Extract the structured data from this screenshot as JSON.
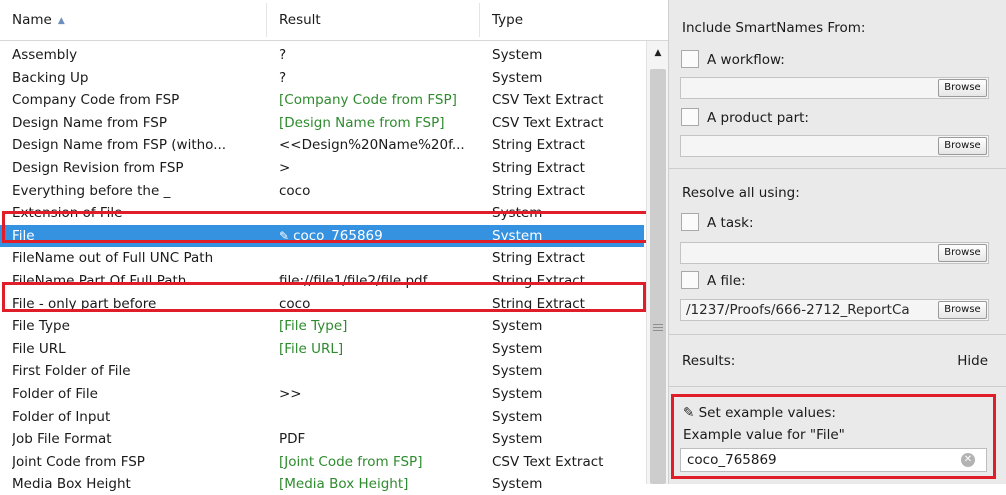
{
  "table": {
    "columns": [
      "Name",
      "Result",
      "Type"
    ],
    "sort_indicator": "▲",
    "rows": [
      {
        "name": "Assembly",
        "result": "?",
        "type": "System",
        "green": false
      },
      {
        "name": "Backing Up",
        "result": "?",
        "type": "System",
        "green": false
      },
      {
        "name": "Company Code from FSP",
        "result": "[Company Code from FSP]",
        "type": "CSV Text Extract",
        "green": true
      },
      {
        "name": "Design Name from FSP",
        "result": "[Design Name from FSP]",
        "type": "CSV Text Extract",
        "green": true
      },
      {
        "name": "Design Name from FSP (witho...",
        "result": "<<Design%20Name%20f...",
        "type": "String Extract",
        "green": false
      },
      {
        "name": "Design Revision from FSP",
        "result": ">",
        "type": "String Extract",
        "green": false
      },
      {
        "name": "Everything before the _",
        "result": "coco",
        "type": "String Extract",
        "green": false
      },
      {
        "name": "Extension of File",
        "result": "",
        "type": "System",
        "green": false
      },
      {
        "name": "File",
        "result": "coco_765869",
        "type": "System",
        "green": false,
        "selected": true,
        "edit_icon": "pencil-icon"
      },
      {
        "name": "FileName out of Full UNC Path",
        "result": "",
        "type": "String Extract",
        "green": false
      },
      {
        "name": "FileName Part Of Full Path",
        "result": "file://file1/file2/file.pdf",
        "type": "String Extract",
        "green": false
      },
      {
        "name": "File - only part before _",
        "result": "coco",
        "type": "String Extract",
        "green": false
      },
      {
        "name": "File Type",
        "result": "[File Type]",
        "type": "System",
        "green": true
      },
      {
        "name": "File URL",
        "result": "[File URL]",
        "type": "System",
        "green": true
      },
      {
        "name": "First Folder of File",
        "result": "",
        "type": "System",
        "green": false
      },
      {
        "name": "Folder of File",
        "result": ">>",
        "type": "System",
        "green": false
      },
      {
        "name": "Folder of Input",
        "result": "",
        "type": "System",
        "green": false
      },
      {
        "name": "Job File Format",
        "result": "PDF",
        "type": "System",
        "green": false
      },
      {
        "name": "Joint Code from FSP",
        "result": "[Joint Code from FSP]",
        "type": "CSV Text Extract",
        "green": true
      },
      {
        "name": "Media Box Height",
        "result": "[Media Box Height]",
        "type": "System",
        "green": true
      }
    ]
  },
  "panel": {
    "include_title": "Include SmartNames From:",
    "workflow_label": "A workflow:",
    "workflow_value": "",
    "product_part_label": "A product part:",
    "product_part_value": "",
    "browse_label": "Browse",
    "resolve_title": "Resolve all using:",
    "task_label": "A task:",
    "task_value": "",
    "file_label": "A file:",
    "file_value": "/1237/Proofs/666-2712_ReportCa",
    "results_label": "Results:",
    "hide_label": "Hide",
    "example_title": "Set example values:",
    "example_label": "Example value for \"File\"",
    "example_value": "coco_765869"
  },
  "colors": {
    "selection": "#3492e0",
    "highlight_box": "#e01e2a",
    "green_value": "#2e8b2e"
  }
}
